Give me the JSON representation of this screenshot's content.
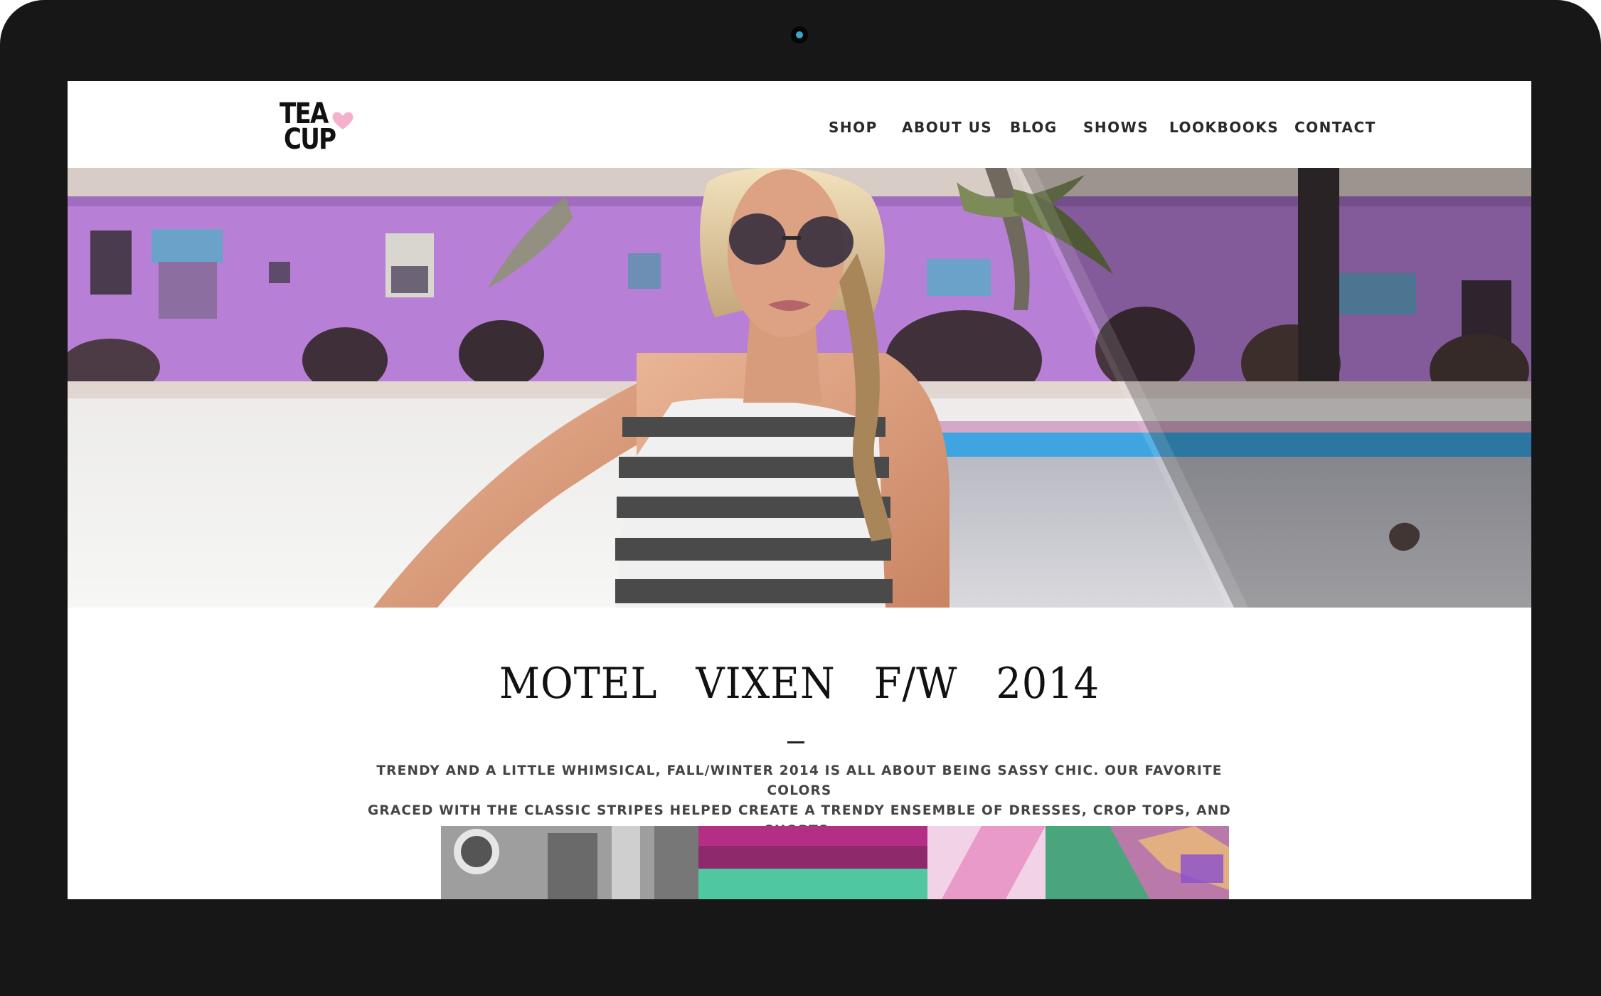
{
  "site": {
    "logo_text": {
      "line1": "TEA",
      "line2": "CUP"
    },
    "nav": [
      {
        "label": "SHOP"
      },
      {
        "label": "ABOUT US"
      },
      {
        "label": "BLOG"
      },
      {
        "label": "SHOWS"
      },
      {
        "label": "LOOKBOOKS"
      },
      {
        "label": "CONTACT"
      }
    ]
  },
  "collection": {
    "title": "MOTEL VIXEN F/W 2014",
    "description_line1": "TRENDY AND A LITTLE WHIMSICAL, FALL/WINTER 2014 IS ALL ABOUT BEING SASSY CHIC. OUR FAVORITE COLORS",
    "description_line2": "GRACED WITH THE CLASSIC STRIPES HELPED CREATE A TRENDY ENSEMBLE OF DRESSES, CROP TOPS, AND SHORTS."
  },
  "colors": {
    "device_frame": "#171717",
    "camera_lens": "#38a6c9",
    "logo_heart": "#f4a9c4",
    "motel_wall": "#b87fd6",
    "pool_trim": "#3ea5e0"
  },
  "icons": {
    "logo_heart": "heart-icon"
  }
}
